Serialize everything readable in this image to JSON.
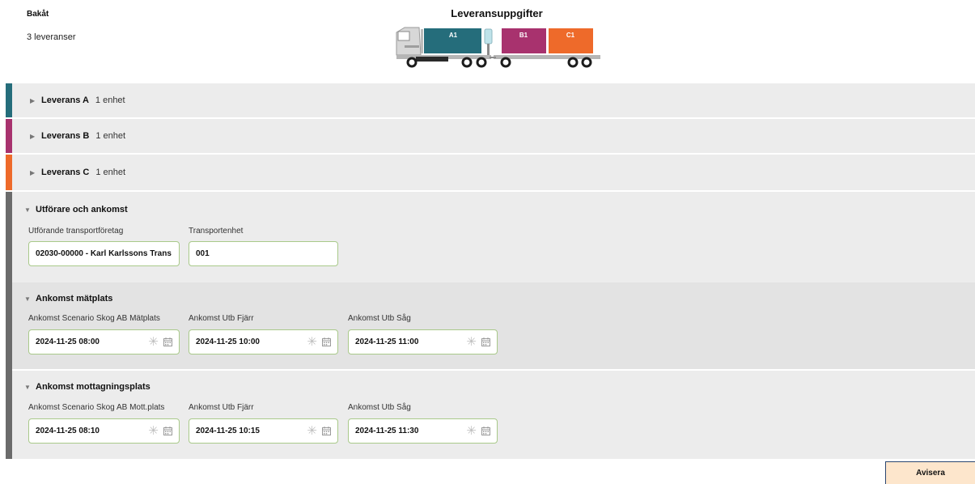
{
  "header": {
    "back_label": "Bakåt",
    "title": "Leveransuppgifter",
    "delivery_count": "3 leveranser"
  },
  "truck": {
    "compartments": [
      {
        "label": "A1",
        "color": "#256d7b"
      },
      {
        "label": "B1",
        "color": "#a8326e"
      },
      {
        "label": "C1",
        "color": "#ee6a2a"
      }
    ]
  },
  "deliveries": [
    {
      "title": "Leverans A",
      "units": "1 enhet",
      "color": "#256d7b"
    },
    {
      "title": "Leverans B",
      "units": "1 enhet",
      "color": "#a8326e"
    },
    {
      "title": "Leverans C",
      "units": "1 enhet",
      "color": "#ee6a2a"
    }
  ],
  "executor_section": {
    "title": "Utförare och ankomst",
    "company_label": "Utförande transportföretag",
    "company_value": "02030-00000 - Karl Karlssons Trans",
    "unit_label": "Transportenhet",
    "unit_value": "001"
  },
  "measure_section": {
    "title": "Ankomst mätplats",
    "fields": [
      {
        "label": "Ankomst Scenario Skog AB Mätplats",
        "value": "2024-11-25 08:00"
      },
      {
        "label": "Ankomst Utb Fjärr",
        "value": "2024-11-25 10:00"
      },
      {
        "label": "Ankomst Utb Såg",
        "value": "2024-11-25 11:00"
      }
    ]
  },
  "receiving_section": {
    "title": "Ankomst mottagningsplats",
    "fields": [
      {
        "label": "Ankomst Scenario Skog AB Mott.plats",
        "value": "2024-11-25 08:10"
      },
      {
        "label": "Ankomst Utb Fjärr",
        "value": "2024-11-25 10:15"
      },
      {
        "label": "Ankomst Utb Såg",
        "value": "2024-11-25 11:30"
      }
    ]
  },
  "icons": {
    "collapsed": "caret-right-icon",
    "expanded": "caret-down-icon",
    "clear": "asterisk-clear-icon",
    "calendar": "calendar-icon"
  },
  "actions": {
    "notify_label": "Avisera",
    "neutral_stripe": "#6b6b6b",
    "field_border": "#a9c98a",
    "button_fill": "#fde6cc"
  }
}
